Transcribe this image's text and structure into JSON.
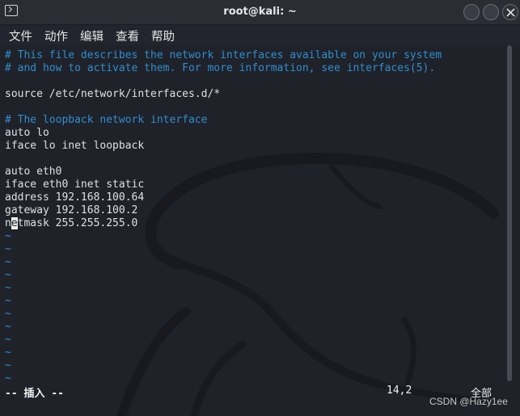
{
  "window": {
    "title": "root@kali: ~"
  },
  "menu": {
    "items": [
      "文件",
      "动作",
      "编辑",
      "查看",
      "帮助"
    ]
  },
  "editor": {
    "lines": [
      {
        "text": "# This file describes the network interfaces available on your system",
        "kind": "comment"
      },
      {
        "text": "# and how to activate them. For more information, see interfaces(5).",
        "kind": "comment"
      },
      {
        "text": "",
        "kind": "code"
      },
      {
        "text": "source /etc/network/interfaces.d/*",
        "kind": "code"
      },
      {
        "text": "",
        "kind": "code"
      },
      {
        "text": "# The loopback network interface",
        "kind": "comment"
      },
      {
        "text": "auto lo",
        "kind": "code"
      },
      {
        "text": "iface lo inet loopback",
        "kind": "code"
      },
      {
        "text": "",
        "kind": "code"
      },
      {
        "text": "auto eth0",
        "kind": "code"
      },
      {
        "text": "iface eth0 inet static",
        "kind": "code"
      },
      {
        "text": "address 192.168.100.64",
        "kind": "code"
      },
      {
        "text": "gateway 192.168.100.2",
        "kind": "code"
      },
      {
        "text": "netmask 255.255.255.0",
        "kind": "cursor",
        "before": "n",
        "cursor": "e",
        "after": "tmask 255.255.255.0"
      }
    ],
    "tilde": "~",
    "tilde_count": 12
  },
  "statusbar": {
    "mode": "-- 插入 --",
    "position": "14,2",
    "scroll": "全部"
  },
  "watermark": "CSDN @Hazy1ee",
  "colors": {
    "background": "#20222a",
    "comment": "#2d8fcf",
    "text": "#e0e0e0"
  }
}
